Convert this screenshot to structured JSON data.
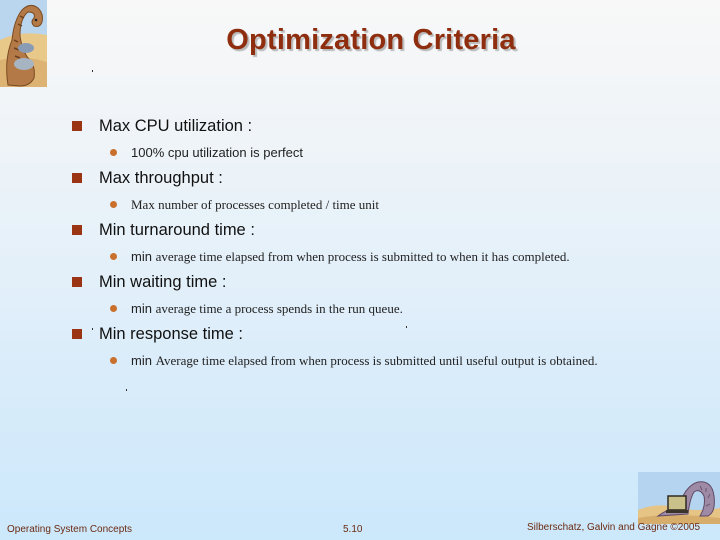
{
  "slide": {
    "title": "Optimization Criteria",
    "items": [
      {
        "label": "Max CPU utilization :",
        "sub_prefix": "",
        "sub_text": "100% cpu utilization is perfect",
        "sub_style": "sans"
      },
      {
        "label": "Max throughput :",
        "sub_prefix": "",
        "sub_text": "Max number of processes completed / time unit",
        "sub_style": "serif"
      },
      {
        "label": "Min turnaround time :",
        "sub_prefix": "min ",
        "sub_text": "average time elapsed from when process is submitted to when it has completed.",
        "sub_style": "serif"
      },
      {
        "label": "Min waiting time :",
        "sub_prefix": "min ",
        "sub_text": "average time a process spends in the run queue.",
        "sub_style": "serif"
      },
      {
        "label": "Min response time :",
        "sub_prefix": "min ",
        "sub_text": "Average time elapsed from when process is submitted until useful output is obtained.",
        "sub_style": "serif"
      }
    ]
  },
  "footer": {
    "left": "Operating System Concepts",
    "center": "5.10",
    "right": "Silberschatz, Galvin and Gagne ©2005"
  },
  "colors": {
    "title": "#8f2d0f",
    "main_bullet": "#9a3413",
    "sub_bullet": "#c9702c",
    "footer_text": "#6b2a12",
    "background_top": "#f8f8f8",
    "background_bottom": "#cce8fb"
  },
  "icons": {
    "top_logo": "dinosaur-logo-icon",
    "bottom_logo": "dinosaur-laptop-logo-icon",
    "main_bullet": "square-bullet-icon",
    "sub_bullet": "round-bullet-icon"
  }
}
